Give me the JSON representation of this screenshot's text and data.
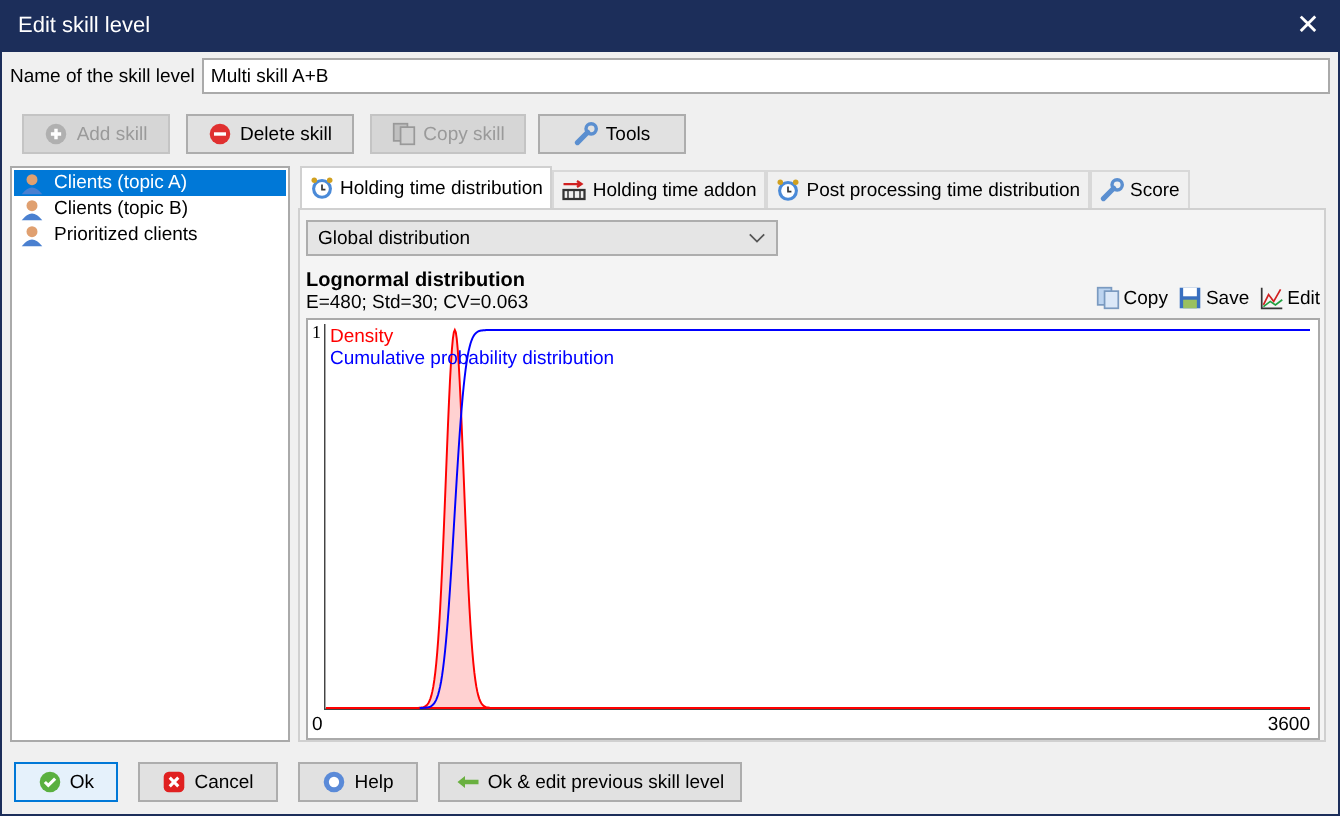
{
  "window": {
    "title": "Edit skill level",
    "close": "✕"
  },
  "name_field": {
    "label": "Name of the skill level",
    "value": "Multi skill A+B"
  },
  "toolbar": [
    {
      "label": "Add skill",
      "kind": "add",
      "disabled": true
    },
    {
      "label": "Delete skill",
      "kind": "delete",
      "disabled": false
    },
    {
      "label": "Copy skill",
      "kind": "copy",
      "disabled": true
    },
    {
      "label": "Tools",
      "kind": "tools",
      "disabled": false
    }
  ],
  "skills": [
    {
      "label": "Clients (topic A)",
      "selected": true
    },
    {
      "label": "Clients (topic B)",
      "selected": false
    },
    {
      "label": "Prioritized clients",
      "selected": false
    }
  ],
  "tabs": [
    {
      "label": "Holding time distribution",
      "kind": "clock",
      "selected": true
    },
    {
      "label": "Holding time addon",
      "kind": "addon",
      "selected": false
    },
    {
      "label": "Post processing time distribution",
      "kind": "clock",
      "selected": false
    },
    {
      "label": "Score",
      "kind": "wrench",
      "selected": false
    }
  ],
  "dropdown": {
    "value": "Global distribution"
  },
  "distribution": {
    "title": "Lognormal distribution",
    "stats": "E=480; Std=30; CV=0.063",
    "actions": [
      {
        "label": "Copy",
        "kind": "copy"
      },
      {
        "label": "Save",
        "kind": "save"
      },
      {
        "label": "Edit",
        "kind": "edit"
      }
    ],
    "legend": [
      {
        "label": "Density",
        "color": "#ff0000"
      },
      {
        "label": "Cumulative probability distribution",
        "color": "#0000ff"
      }
    ],
    "y_tick": "1",
    "x_min": "0",
    "x_max": "3600"
  },
  "buttons": [
    {
      "label": "Ok",
      "kind": "ok",
      "focused": true
    },
    {
      "label": "Cancel",
      "kind": "cancel",
      "focused": false
    },
    {
      "label": "Help",
      "kind": "help",
      "focused": false
    },
    {
      "label": "Ok & edit previous skill level",
      "kind": "back",
      "focused": false
    }
  ]
}
